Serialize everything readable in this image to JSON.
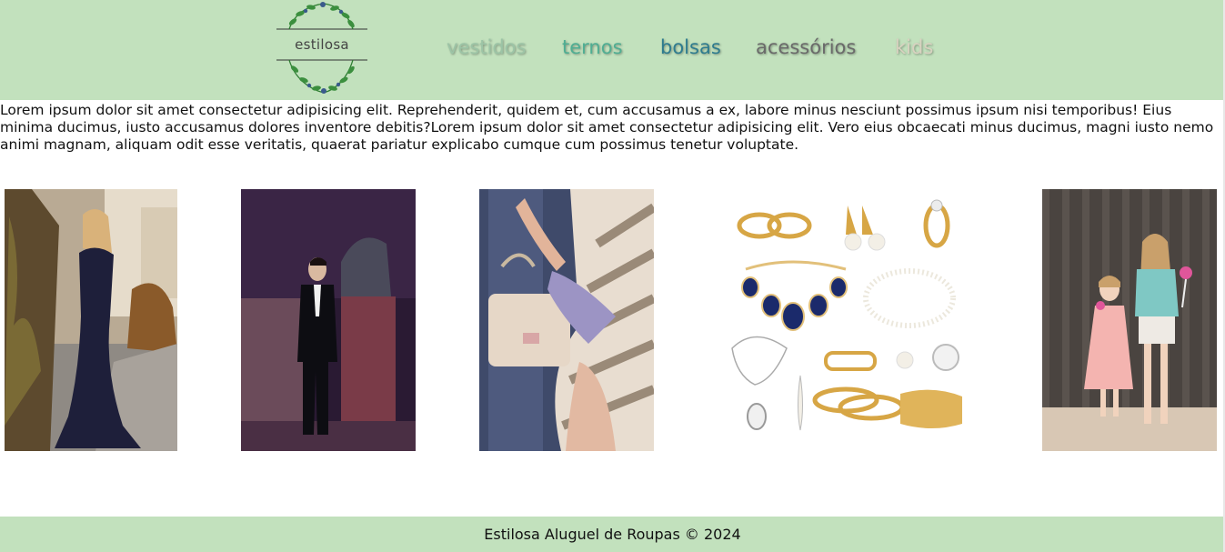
{
  "header": {
    "logo_text": "estilosa",
    "nav": [
      {
        "label": "vestidos",
        "color": "#9cc4a6"
      },
      {
        "label": "ternos",
        "color": "#4fae93"
      },
      {
        "label": "bolsas",
        "color": "#2f7c8f"
      },
      {
        "label": "acessórios",
        "color": "#6a6a6a"
      },
      {
        "label": "kids",
        "color": "#d8d2c0"
      }
    ]
  },
  "intro_text": "Lorem ipsum dolor sit amet consectetur adipisicing elit. Reprehenderit, quidem et, cum accusamus a ex, labore minus nesciunt possimus ipsum nisi temporibus! Eius minima ducimus, iusto accusamus dolores inventore debitis?Lorem ipsum dolor sit amet consectetur adipisicing elit. Vero eius obcaecati minus ducimus, magni iusto nemo animi magnam, aliquam odit esse veritatis, quaerat pariatur explicabo cumque cum possimus tenetur voluptate.",
  "gallery": [
    {
      "subject": "woman-in-evening-gown"
    },
    {
      "subject": "man-in-tuxedo"
    },
    {
      "subject": "woman-with-handbag"
    },
    {
      "subject": "jewelry-accessories"
    },
    {
      "subject": "two-girls-kids"
    }
  ],
  "footer_text": "Estilosa Aluguel de Roupas © 2024",
  "colors": {
    "header_bg": "#c2e1bd",
    "footer_bg": "#c2e1bd"
  }
}
